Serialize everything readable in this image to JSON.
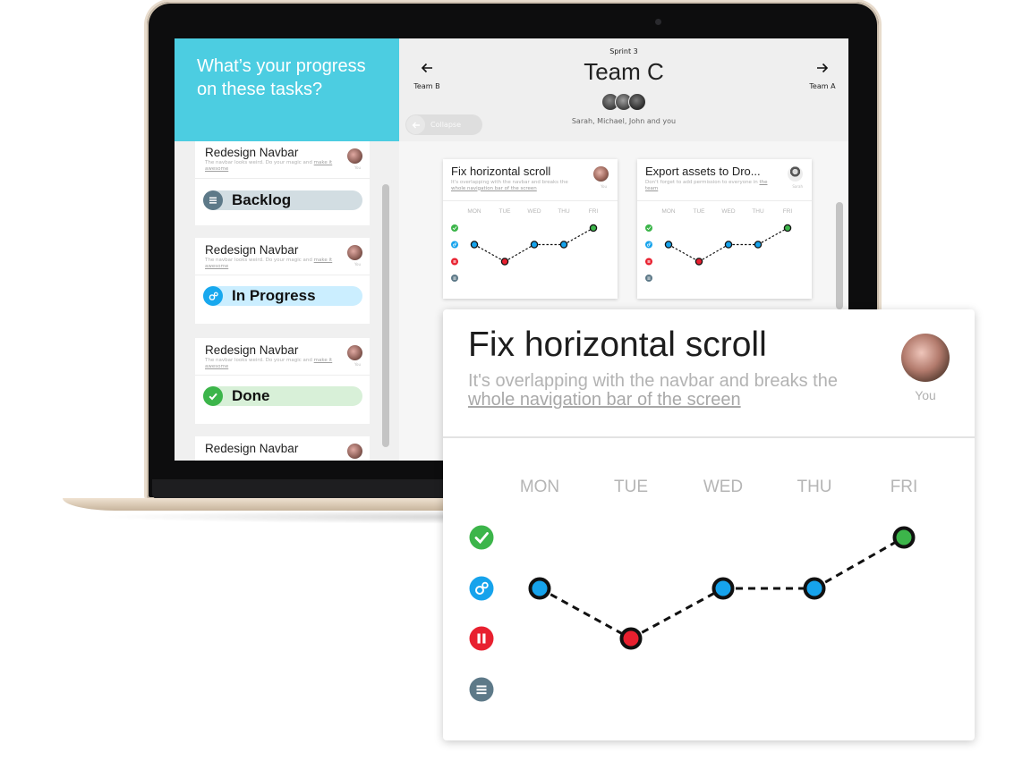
{
  "left_pane": {
    "question": "What’s your progress on these tasks?",
    "tasks": [
      {
        "title": "Redesign Navbar",
        "desc": "The navbar looks weird. Do your magic and",
        "link": "make it awesome",
        "avatar_label": "You",
        "status": "Backlog",
        "status_icon": "list-icon",
        "status_bg": "#d2dde2",
        "icon_bg": "#5d7988"
      },
      {
        "title": "Redesign Navbar",
        "desc": "The navbar looks weird. Do your magic and",
        "link": "make it awesome",
        "avatar_label": "You",
        "status": "In Progress",
        "status_icon": "gears-icon",
        "status_bg": "#cbeeff",
        "icon_bg": "#18a8ee"
      },
      {
        "title": "Redesign Navbar",
        "desc": "The navbar looks weird. Do your magic and",
        "link": "make it awesome",
        "avatar_label": "You",
        "status": "Done",
        "status_icon": "check-icon",
        "status_bg": "#d8f0d8",
        "icon_bg": "#3cb54a"
      },
      {
        "title": "Redesign Navbar"
      }
    ]
  },
  "header": {
    "sprint": "Sprint 3",
    "team": "Team C",
    "members": "Sarah, Michael, John and you",
    "prev_team": "Team B",
    "next_team": "Team A",
    "collapse_label": "Collapse"
  },
  "cards": [
    {
      "title": "Fix horizontal scroll",
      "desc": "It's overlapping with the navbar and breaks the",
      "link": "whole navigation bar of the screen",
      "avatar_label": "You"
    },
    {
      "title": "Export assets to Dro...",
      "desc": "Don't forget to add permission to everyone in",
      "link": "the team",
      "avatar_label": "Sarah"
    }
  ],
  "detail": {
    "title": "Fix horizontal scroll",
    "desc": "It's overlapping with the navbar and breaks the",
    "link": "whole navigation bar of the screen",
    "avatar_label": "You"
  },
  "chart_data": {
    "type": "line",
    "categories": [
      "MON",
      "TUE",
      "WED",
      "THU",
      "FRI"
    ],
    "status_levels": [
      "Done",
      "In Progress",
      "Paused",
      "Backlog"
    ],
    "status_icons": [
      "check-icon",
      "gears-icon",
      "pause-icon",
      "list-icon"
    ],
    "status_colors": [
      "#3cb54a",
      "#16a3ec",
      "#e8202f",
      "#5d7988"
    ],
    "series": [
      {
        "values": [
          "In Progress",
          "Paused",
          "In Progress",
          "In Progress",
          "Done"
        ]
      },
      {
        "values": [
          "In Progress",
          "Paused",
          "In Progress",
          "In Progress",
          "Done"
        ]
      }
    ]
  },
  "colors": {
    "accent": "#4ccde1",
    "done": "#3cb54a",
    "in_progress": "#16a3ec",
    "paused": "#e8202f",
    "backlog": "#5d7988"
  }
}
